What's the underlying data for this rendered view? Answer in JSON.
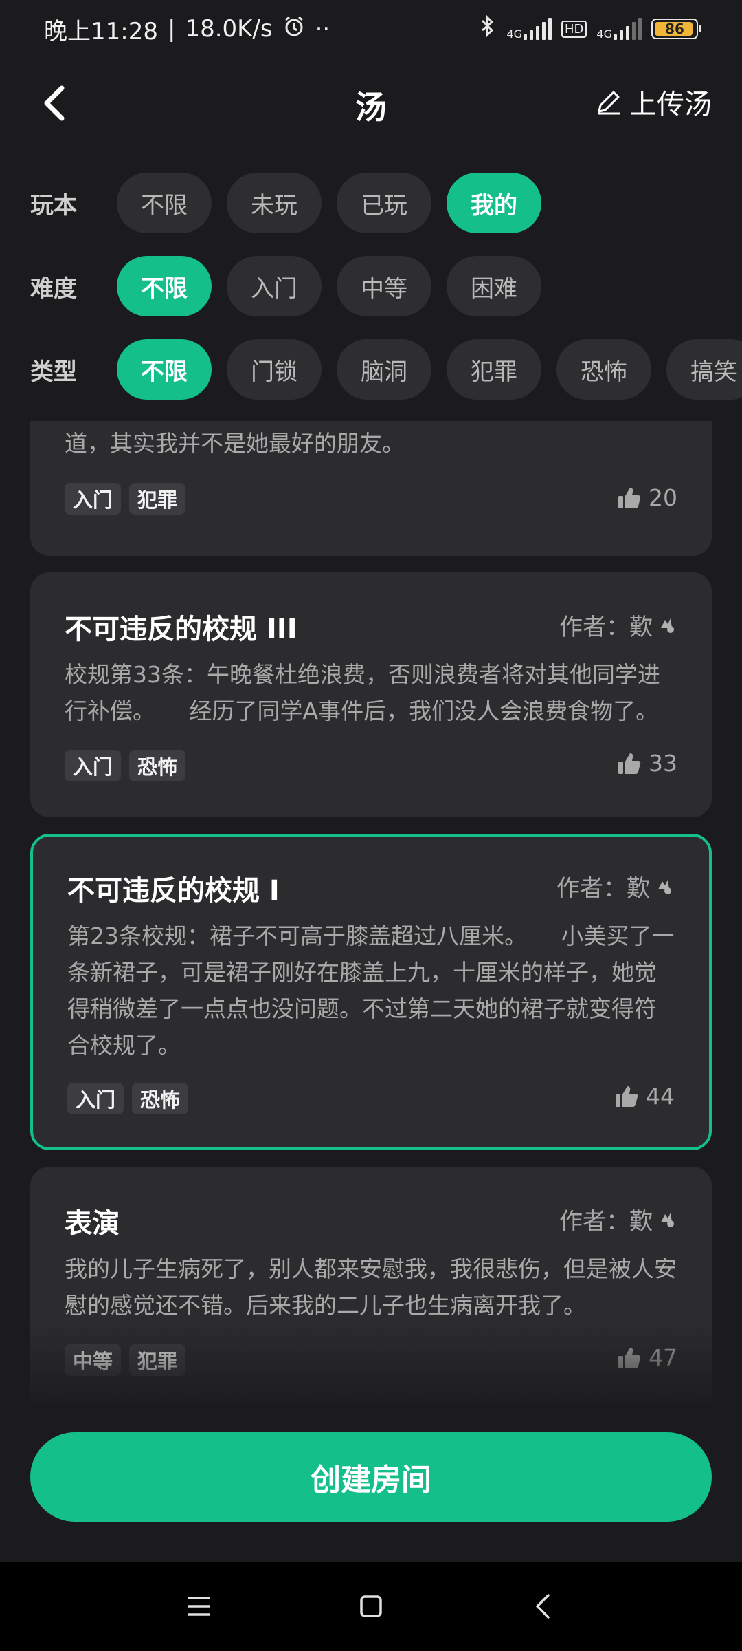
{
  "status": {
    "time": "晚上11:28",
    "speed": "18.0K/s",
    "dots": "··",
    "net1": "4G",
    "hd": "HD",
    "net2": "4G",
    "battery": "86",
    "icons": [
      "alarm-icon",
      "bluetooth-icon",
      "signal-icon",
      "battery-icon"
    ]
  },
  "header": {
    "title": "汤",
    "upload_label": "上传汤"
  },
  "filters": {
    "play": {
      "label": "玩本",
      "options": [
        "不限",
        "未玩",
        "已玩",
        "我的"
      ],
      "selected": "我的"
    },
    "difficulty": {
      "label": "难度",
      "options": [
        "不限",
        "入门",
        "中等",
        "困难"
      ],
      "selected": "不限"
    },
    "type": {
      "label": "类型",
      "options": [
        "不限",
        "门锁",
        "脑洞",
        "犯罪",
        "恐怖",
        "搞笑"
      ],
      "selected": "不限"
    }
  },
  "cards": [
    {
      "title": "",
      "author": "",
      "description": "道，其实我并不是她最好的朋友。",
      "tags": [
        "入门",
        "犯罪"
      ],
      "likes": "20"
    },
    {
      "title": "不可违反的校规 III",
      "author": "作者：歎",
      "description": "校规第33条：午晚餐杜绝浪费，否则浪费者将对其他同学进行补偿。　　经历了同学A事件后，我们没人会浪费食物了。",
      "tags": [
        "入门",
        "恐怖"
      ],
      "likes": "33"
    },
    {
      "title": "不可违反的校规 I",
      "author": "作者：歎",
      "description": "第23条校规：裙子不可高于膝盖超过八厘米。　　小美买了一条新裙子，可是裙子刚好在膝盖上九，十厘米的样子，她觉得稍微差了一点点也没问题。不过第二天她的裙子就变得符合校规了。",
      "tags": [
        "入门",
        "恐怖"
      ],
      "likes": "44",
      "selected": true
    },
    {
      "title": "表演",
      "author": "作者：歎",
      "description": "我的儿子生病死了，别人都来安慰我，我很悲伤，但是被人安慰的感觉还不错。后来我的二儿子也生病离开我了。",
      "tags": [
        "中等",
        "犯罪"
      ],
      "likes": "47"
    }
  ],
  "create_room_label": "创建房间",
  "accent_color": "#15bf8a",
  "nav": [
    "menu-icon",
    "home-icon",
    "back-icon"
  ]
}
